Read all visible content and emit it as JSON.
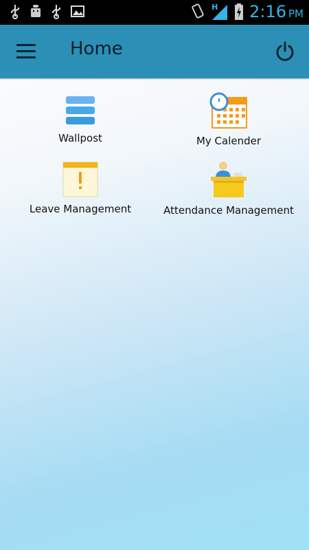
{
  "status_bar": {
    "left_icons": [
      "usb-icon",
      "android-debug-icon",
      "usb-icon",
      "image-icon"
    ],
    "right_icons": [
      "rotate-icon",
      "signal-icon",
      "battery-icon"
    ],
    "network_type": "H",
    "time": "2:16",
    "ampm": "PM"
  },
  "app_bar": {
    "title": "Home",
    "menu_icon": "menu-icon",
    "power_icon": "power-icon"
  },
  "tiles": [
    {
      "label": "Wallpost",
      "icon": "wallpost-icon"
    },
    {
      "label": "My Calender",
      "icon": "calendar-icon"
    },
    {
      "label": "Leave Management",
      "icon": "leave-note-icon"
    },
    {
      "label": "Attendance Management",
      "icon": "attendance-desk-icon"
    }
  ],
  "colors": {
    "status_bar_bg": "#000000",
    "clock": "#33b5e5",
    "app_bar_bg": "#2c8fb6",
    "accent_orange": "#f59a1b",
    "accent_blue": "#4aa7e8"
  }
}
